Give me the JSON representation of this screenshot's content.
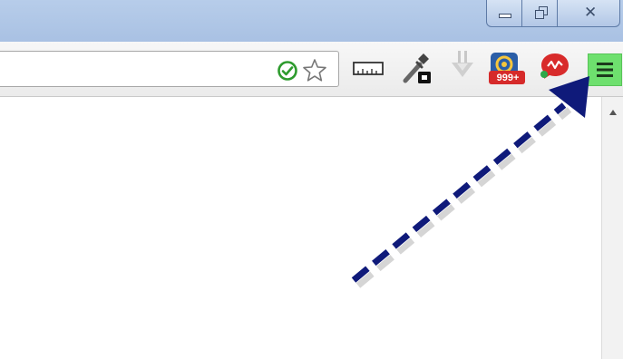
{
  "window_controls": {
    "minimize_icon": "minimize-icon",
    "maximize_icon": "restore-icon",
    "close_icon": "close-icon",
    "close_glyph": "✕"
  },
  "omnibox": {
    "value": ""
  },
  "toolbar": {
    "icons": [
      "verified-check-icon",
      "bookmark-star-icon",
      "ruler-extension-icon",
      "eyedropper-extension-icon",
      "download-extension-icon",
      "mail-extension-icon",
      "chat-extension-icon",
      "chrome-menu-icon"
    ],
    "mail_badge": "999+",
    "menu_highlight_color": "#6ee06e"
  },
  "annotation": {
    "arrow_color": "#0f1a7a"
  }
}
